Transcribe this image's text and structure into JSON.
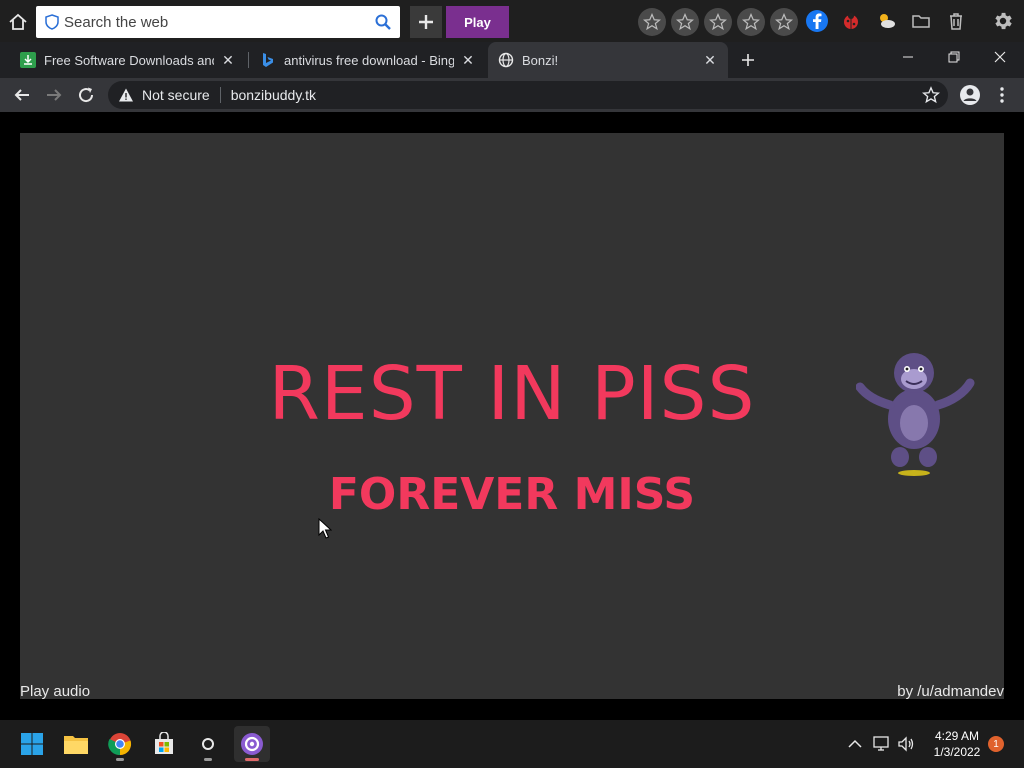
{
  "toolbar": {
    "search_placeholder": "Search the web",
    "play_label": "Play"
  },
  "tabs": [
    {
      "title": "Free Software Downloads and Reviews",
      "favicon": "green-download-icon"
    },
    {
      "title": "antivirus free download - Bing",
      "favicon": "bing-icon"
    },
    {
      "title": "Bonzi!",
      "favicon": "globe-icon",
      "active": true
    }
  ],
  "address": {
    "security_text": "Not secure",
    "url": "bonzibuddy.tk"
  },
  "page": {
    "headline": "REST IN PISS",
    "subheadline": "FOREVER MISS",
    "play_audio": "Play audio",
    "credit": "by /u/admandev",
    "accent_color": "#f2395d"
  },
  "taskbar": {
    "time": "4:29 AM",
    "date": "1/3/2022",
    "notification_count": "1"
  }
}
